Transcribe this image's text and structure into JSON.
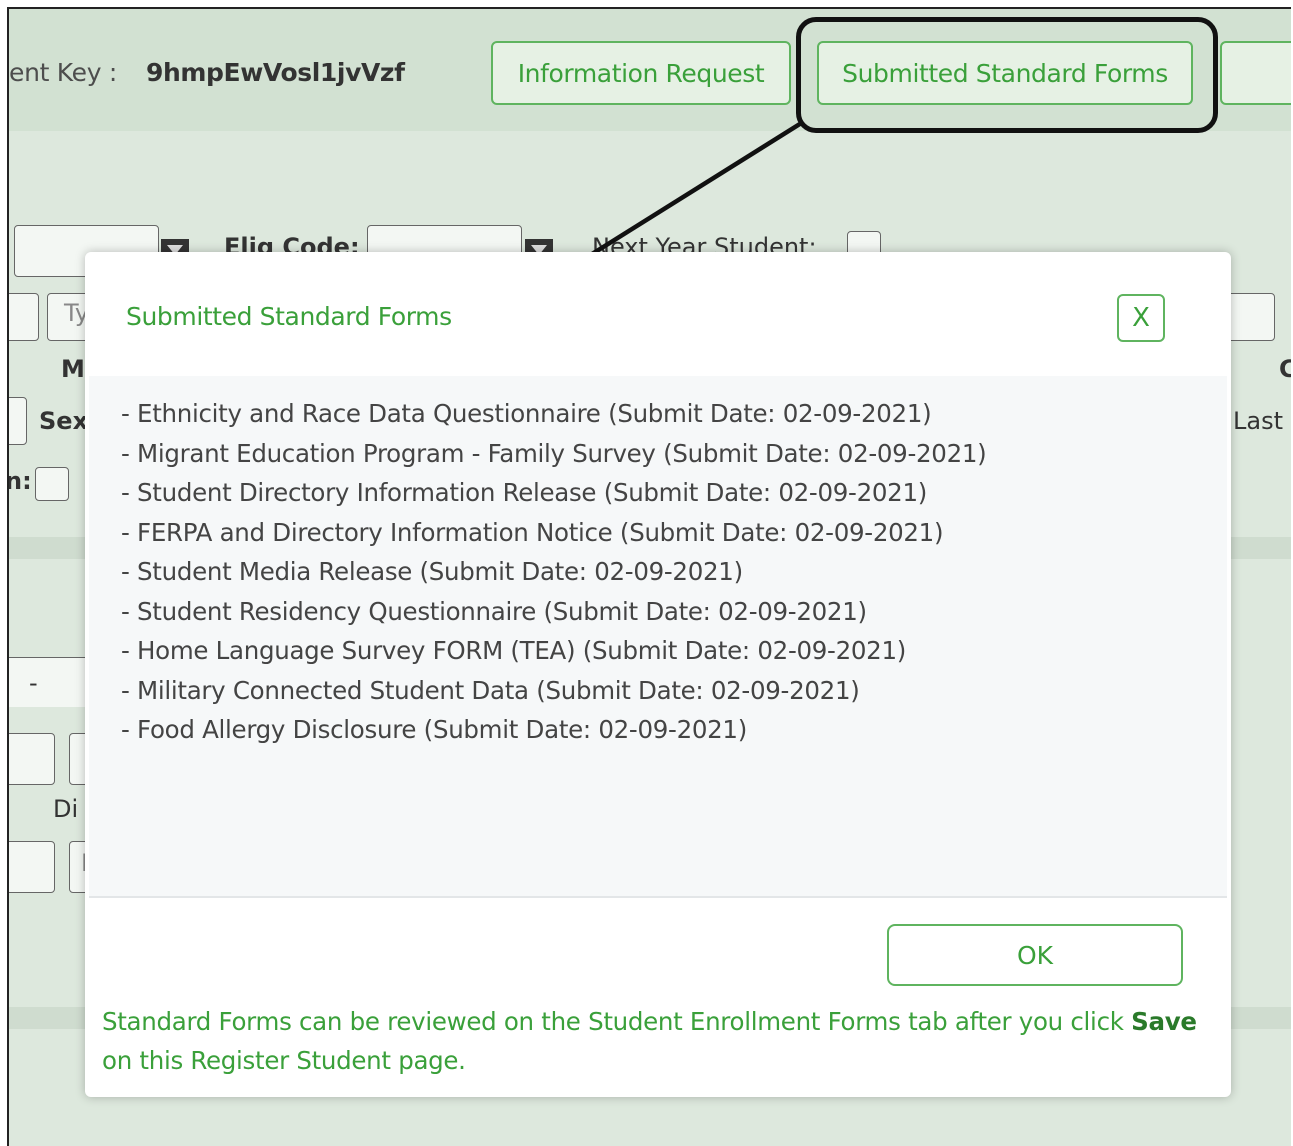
{
  "header": {
    "student_key_label": "ent Key :",
    "student_key_value": "9hmpEwVosl1jvVzf",
    "buttons": {
      "information_request": "Information Request",
      "submitted_standard_forms": "Submitted Standard Forms"
    }
  },
  "background": {
    "elig_code_label": "Elig Code:",
    "next_year_label": "Next Year Student:",
    "type_fragment": "Ty",
    "m_fragment": "M",
    "sex_fragment": "Sex",
    "last_fragment": "Last",
    "c_fragment": "C",
    "colon_fragment": "n:",
    "dash_fragment": "-",
    "di_fragment": "Di",
    "n_fragment": "N"
  },
  "modal": {
    "title": "Submitted Standard Forms",
    "close_label": "X",
    "forms": [
      "- Ethnicity and Race Data Questionnaire (Submit Date: 02-09-2021)",
      "- Migrant Education Program - Family Survey (Submit Date: 02-09-2021)",
      "- Student Directory Information Release (Submit Date: 02-09-2021)",
      "- FERPA and Directory Information Notice (Submit Date: 02-09-2021)",
      "- Student Media Release (Submit Date: 02-09-2021)",
      "- Student Residency Questionnaire (Submit Date: 02-09-2021)",
      "- Home Language Survey FORM (TEA) (Submit Date: 02-09-2021)",
      "- Military Connected Student Data (Submit Date: 02-09-2021)",
      "- Food Allergy Disclosure (Submit Date: 02-09-2021)"
    ],
    "ok_label": "OK",
    "footnote_before": "Standard Forms can be reviewed on the Student Enrollment Forms tab after you click ",
    "footnote_bold": "Save",
    "footnote_after": " on this Register Student page."
  }
}
